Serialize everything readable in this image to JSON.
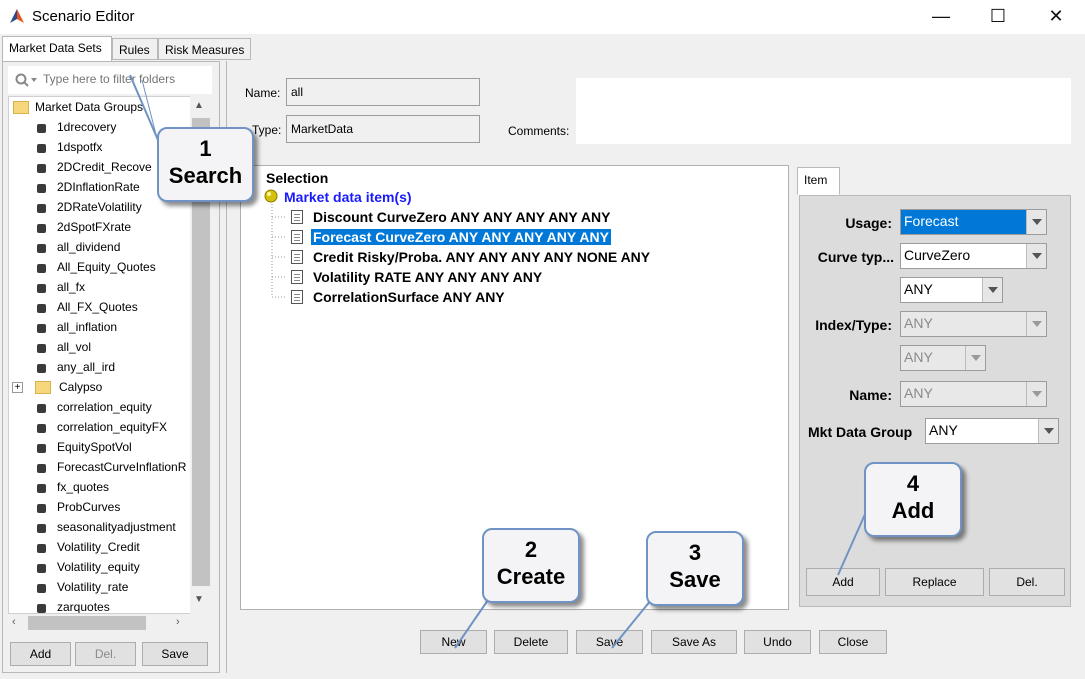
{
  "window": {
    "title": "Scenario Editor",
    "minimize": "—",
    "maximize": "☐",
    "close": "✕"
  },
  "tabs": [
    "Market Data Sets",
    "Rules",
    "Risk Measures"
  ],
  "left": {
    "filter_placeholder": "Type here to filter folders",
    "root": "Market Data Groups",
    "items": [
      "1drecovery",
      "1dspotfx",
      "2DCredit_Recove",
      "2DInflationRate",
      "2DRateVolatility",
      "2dSpotFXrate",
      "all_dividend",
      "All_Equity_Quotes",
      "all_fx",
      "All_FX_Quotes",
      "all_inflation",
      "all_vol",
      "any_all_ird"
    ],
    "folder": "Calypso",
    "items2": [
      "correlation_equity",
      "correlation_equityFX",
      "EquitySpotVol",
      "ForecastCurveInflationR",
      "fx_quotes",
      "ProbCurves",
      "seasonalityadjustment",
      "Volatility_Credit",
      "Volatility_equity",
      "Volatility_rate",
      "zarquotes"
    ],
    "buttons": {
      "add": "Add",
      "del": "Del.",
      "save": "Save"
    }
  },
  "form": {
    "name_label": "Name:",
    "name_value": "all",
    "type_label": "Type:",
    "type_value": "MarketData",
    "comments_label": "Comments:"
  },
  "selection": {
    "title": "Selection",
    "root": "Market data item(s)",
    "items": [
      "Discount CurveZero ANY ANY ANY ANY ANY",
      "Forecast CurveZero ANY ANY ANY ANY ANY",
      "Credit Risky/Proba. ANY ANY ANY ANY NONE ANY",
      "Volatility RATE ANY ANY ANY ANY",
      "CorrelationSurface ANY ANY"
    ]
  },
  "item_panel": {
    "tab": "Item",
    "usage_label": "Usage:",
    "usage_value": "Forecast",
    "curve_type_label": "Curve typ...",
    "curve_type_value": "CurveZero",
    "sub_value": "ANY",
    "index_label": "Index/Type:",
    "index_value": "ANY",
    "index_sub_value": "ANY",
    "name_label": "Name:",
    "name_value": "ANY",
    "mkt_group_label": "Mkt Data Group",
    "mkt_group_value": "ANY",
    "buttons": {
      "add": "Add",
      "replace": "Replace",
      "del": "Del."
    }
  },
  "bottom_buttons": {
    "new": "New",
    "delete": "Delete",
    "save": "Save",
    "save_as": "Save As",
    "undo": "Undo",
    "close": "Close"
  },
  "callouts": [
    {
      "num": "1",
      "text": "Search"
    },
    {
      "num": "2",
      "text": "Create"
    },
    {
      "num": "3",
      "text": "Save"
    },
    {
      "num": "4",
      "text": "Add"
    }
  ],
  "colors": {
    "accent": "#0078d7",
    "link_blue": "#1a1aff",
    "callout_border": "#6f93c4"
  }
}
